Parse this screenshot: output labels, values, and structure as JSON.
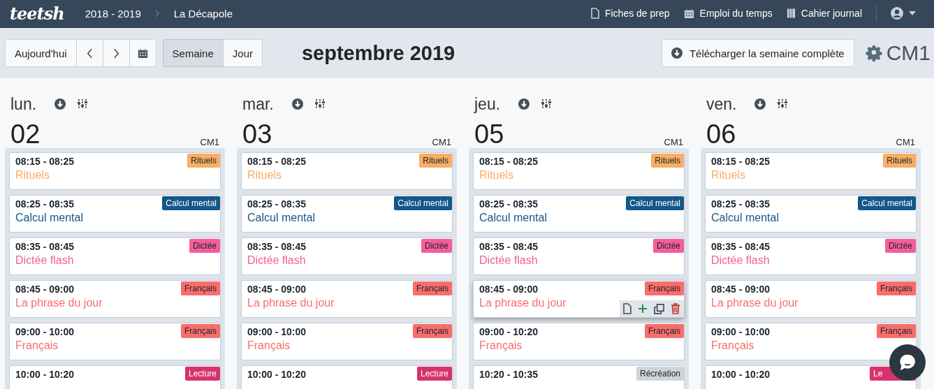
{
  "navbar": {
    "logo": "teetsh",
    "breadcrumb": [
      "2018 - 2019",
      "La Décapole"
    ],
    "links": [
      {
        "label": "Fiches de prep"
      },
      {
        "label": "Emploi du temps"
      },
      {
        "label": "Cahier journal"
      }
    ]
  },
  "toolbar": {
    "today": "Aujourd'hui",
    "views": [
      {
        "label": "Semaine",
        "selected": true
      },
      {
        "label": "Jour",
        "selected": false
      }
    ],
    "title": "septembre 2019",
    "download": "Télécharger la semaine complète",
    "class_name": "CM1"
  },
  "days": [
    {
      "weekday": "lun.",
      "date": "02",
      "class_label": "CM1",
      "events": [
        {
          "time": "08:15 - 08:25",
          "title": "Rituels",
          "badge": "Rituels",
          "color": "#f8ae63"
        },
        {
          "time": "08:25 - 08:35",
          "title": "Calcul mental",
          "badge": "Calcul mental",
          "color": "#13578a"
        },
        {
          "time": "08:35 - 08:45",
          "title": "Dictée flash",
          "badge": "Dictée",
          "color": "#f45e9c"
        },
        {
          "time": "08:45 - 09:00",
          "title": "La phrase du jour",
          "badge": "Français",
          "color": "#f86d6d"
        },
        {
          "time": "09:00 - 10:00",
          "title": "Français",
          "badge": "Français",
          "color": "#f86d6d"
        },
        {
          "time": "10:00 - 10:20",
          "badge": "Lecture",
          "color": "#d6336c"
        }
      ]
    },
    {
      "weekday": "mar.",
      "date": "03",
      "class_label": "CM1",
      "events": [
        {
          "time": "08:15 - 08:25",
          "title": "Rituels",
          "badge": "Rituels",
          "color": "#f8ae63"
        },
        {
          "time": "08:25 - 08:35",
          "title": "Calcul mental",
          "badge": "Calcul mental",
          "color": "#13578a"
        },
        {
          "time": "08:35 - 08:45",
          "title": "Dictée flash",
          "badge": "Dictée",
          "color": "#f45e9c"
        },
        {
          "time": "08:45 - 09:00",
          "title": "La phrase du jour",
          "badge": "Français",
          "color": "#f86d6d"
        },
        {
          "time": "09:00 - 10:00",
          "title": "Français",
          "badge": "Français",
          "color": "#f86d6d"
        },
        {
          "time": "10:00 - 10:20",
          "badge": "Lecture",
          "color": "#d6336c"
        }
      ]
    },
    {
      "weekday": "jeu.",
      "date": "05",
      "class_label": "CM1",
      "events": [
        {
          "time": "08:15 - 08:25",
          "title": "Rituels",
          "badge": "Rituels",
          "color": "#f8ae63"
        },
        {
          "time": "08:25 - 08:35",
          "title": "Calcul mental",
          "badge": "Calcul mental",
          "color": "#13578a"
        },
        {
          "time": "08:35 - 08:45",
          "title": "Dictée flash",
          "badge": "Dictée",
          "color": "#f45e9c"
        },
        {
          "time": "08:45 - 09:00",
          "title": "La phrase du jour",
          "badge": "Français",
          "color": "#f86d6d",
          "hovered": true
        },
        {
          "time": "09:00 - 10:20",
          "title": "Français",
          "badge": "Français",
          "color": "#f86d6d"
        },
        {
          "time": "10:20 - 10:35",
          "badge": "Récréation",
          "color": "#ced4da"
        }
      ]
    },
    {
      "weekday": "ven.",
      "date": "06",
      "class_label": "CM1",
      "events": [
        {
          "time": "08:15 - 08:25",
          "title": "Rituels",
          "badge": "Rituels",
          "color": "#f8ae63"
        },
        {
          "time": "08:25 - 08:35",
          "title": "Calcul mental",
          "badge": "Calcul mental",
          "color": "#13578a"
        },
        {
          "time": "08:35 - 08:45",
          "title": "Dictée flash",
          "badge": "Dictée",
          "color": "#f45e9c"
        },
        {
          "time": "08:45 - 09:00",
          "title": "La phrase du jour",
          "badge": "Français",
          "color": "#f86d6d"
        },
        {
          "time": "09:00 - 10:00",
          "title": "Français",
          "badge": "Français",
          "color": "#f86d6d"
        },
        {
          "time": "10:00 - 10:20",
          "badge": "Le",
          "color": "#d6336c"
        }
      ]
    }
  ]
}
